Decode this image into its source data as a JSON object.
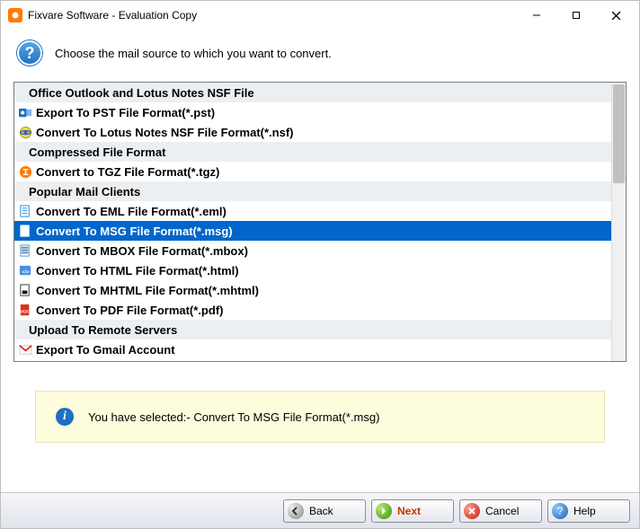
{
  "window": {
    "title": "Fixvare Software - Evaluation Copy"
  },
  "header": {
    "prompt": "Choose the mail source to which you want to convert."
  },
  "list": {
    "rows": [
      {
        "kind": "category",
        "label": "Office Outlook and Lotus Notes NSF File",
        "icon": "none"
      },
      {
        "kind": "option",
        "label": "Export To PST File Format(*.pst)",
        "icon": "outlook"
      },
      {
        "kind": "option",
        "label": "Convert To Lotus Notes NSF File Format(*.nsf)",
        "icon": "notes"
      },
      {
        "kind": "category",
        "label": "Compressed File Format",
        "icon": "none"
      },
      {
        "kind": "option",
        "label": "Convert to TGZ File Format(*.tgz)",
        "icon": "tgz"
      },
      {
        "kind": "category",
        "label": "Popular Mail Clients",
        "icon": "none"
      },
      {
        "kind": "option",
        "label": "Convert To EML File Format(*.eml)",
        "icon": "eml"
      },
      {
        "kind": "option",
        "label": "Convert To MSG File Format(*.msg)",
        "icon": "msg",
        "selected": true
      },
      {
        "kind": "option",
        "label": "Convert To MBOX File Format(*.mbox)",
        "icon": "mbox"
      },
      {
        "kind": "option",
        "label": "Convert To HTML File Format(*.html)",
        "icon": "html"
      },
      {
        "kind": "option",
        "label": "Convert To MHTML File Format(*.mhtml)",
        "icon": "mhtml"
      },
      {
        "kind": "option",
        "label": "Convert To PDF File Format(*.pdf)",
        "icon": "pdf"
      },
      {
        "kind": "category",
        "label": "Upload To Remote Servers",
        "icon": "none"
      },
      {
        "kind": "option",
        "label": "Export To Gmail Account",
        "icon": "gmail"
      }
    ]
  },
  "status": {
    "text": "You have selected:- Convert To MSG File Format(*.msg)"
  },
  "footer": {
    "back": "Back",
    "next": "Next",
    "cancel": "Cancel",
    "help": "Help"
  }
}
